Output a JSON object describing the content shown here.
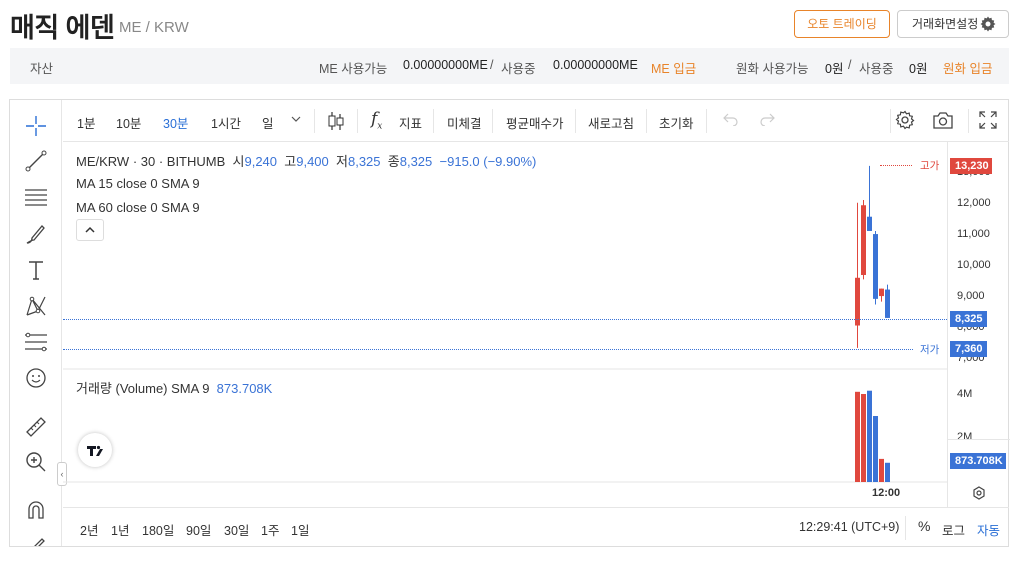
{
  "header": {
    "coin_name": "매직 에덴",
    "pair": "ME / KRW",
    "auto_trading_label": "오토 트레이딩",
    "screen_settings_label": "거래화면설정"
  },
  "assets": {
    "label": "자산",
    "me_available_label": "ME 사용가능",
    "me_available_value": "0.00000000ME",
    "slash1": "/",
    "me_in_use_label": "사용중",
    "me_in_use_value": "0.00000000ME",
    "me_deposit_label": "ME 입금",
    "krw_available_label": "원화 사용가능",
    "krw_available_value": "0원",
    "slash2": "/",
    "krw_in_use_label": "사용중",
    "krw_in_use_value": "0원",
    "krw_deposit_label": "원화 입금"
  },
  "toolbar": {
    "intervals": [
      "1분",
      "10분",
      "30분",
      "1시간",
      "일"
    ],
    "selected_interval": "30분",
    "indicator_label": "지표",
    "unfilled_label": "미체결",
    "avg_price_label": "평균매수가",
    "refresh_label": "새로고침",
    "reset_label": "초기화"
  },
  "legend": {
    "symbol": "ME/KRW · 30 · BITHUMB",
    "open_label": "시",
    "open": "9,240",
    "high_label": "고",
    "high": "9,400",
    "low_label": "저",
    "low": "8,325",
    "close_label": "종",
    "close": "8,325",
    "change": "−915.0 (−9.90%)",
    "ma15": "MA 15 close 0 SMA 9",
    "ma60": "MA 60 close 0 SMA 9",
    "volume_label": "거래량 (Volume) SMA 9",
    "volume_value": "873.708K"
  },
  "price_axis": {
    "ticks": [
      "13,000",
      "12,000",
      "11,000",
      "10,000",
      "9,000",
      "8,000",
      "7,000"
    ],
    "high_tag": "13,230",
    "high_tag_label": "고가",
    "last_tag": "8,325",
    "low_tag": "7,360",
    "low_tag_label": "저가"
  },
  "volume_axis": {
    "ticks": [
      "4M",
      "2M"
    ],
    "last_tag": "873.708K"
  },
  "time_axis": {
    "label": "12:00"
  },
  "bottombar": {
    "ranges": [
      "2년",
      "1년",
      "180일",
      "90일",
      "30일",
      "1주",
      "1일"
    ],
    "clock": "12:29:41 (UTC+9)",
    "percent_label": "%",
    "log_label": "로그",
    "auto_label": "자동"
  },
  "colors": {
    "up": "#e0483e",
    "down": "#3a73d6",
    "accent": "#e8842a"
  },
  "chart_data": {
    "type": "candlestick",
    "candles": [
      {
        "open": 9620,
        "high": 12040,
        "low": 7360,
        "close": 8080,
        "dir": "up"
      },
      {
        "open": 9710,
        "high": 12130,
        "low": 9570,
        "close": 11960,
        "dir": "up"
      },
      {
        "open": 11590,
        "high": 13230,
        "low": 11350,
        "close": 11130,
        "dir": "down"
      },
      {
        "open": 11030,
        "high": 11130,
        "low": 8760,
        "close": 8940,
        "dir": "down"
      },
      {
        "open": 9030,
        "high": 9270,
        "low": 8850,
        "close": 9270,
        "dir": "up"
      },
      {
        "open": 9240,
        "high": 9400,
        "low": 8325,
        "close": 8325,
        "dir": "down"
      }
    ],
    "volumes": [
      4.1,
      4.0,
      4.15,
      3.0,
      1.05,
      0.874
    ]
  }
}
